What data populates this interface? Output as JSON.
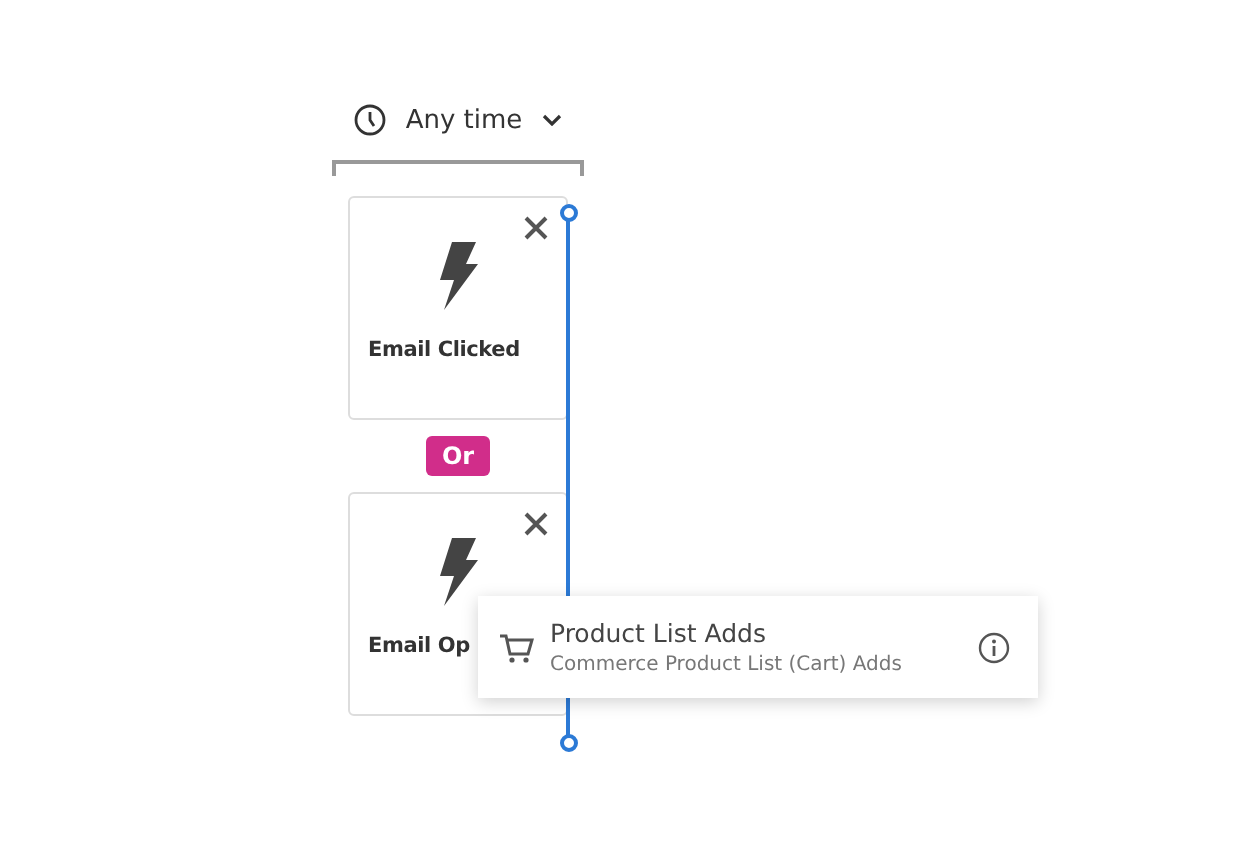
{
  "time_filter": {
    "label": "Any time"
  },
  "events": [
    {
      "title": "Email Clicked"
    },
    {
      "title": "Email Op"
    }
  ],
  "connector": {
    "label": "Or"
  },
  "dragged_item": {
    "title": "Product List Adds",
    "subtitle": "Commerce Product List (Cart) Adds"
  }
}
